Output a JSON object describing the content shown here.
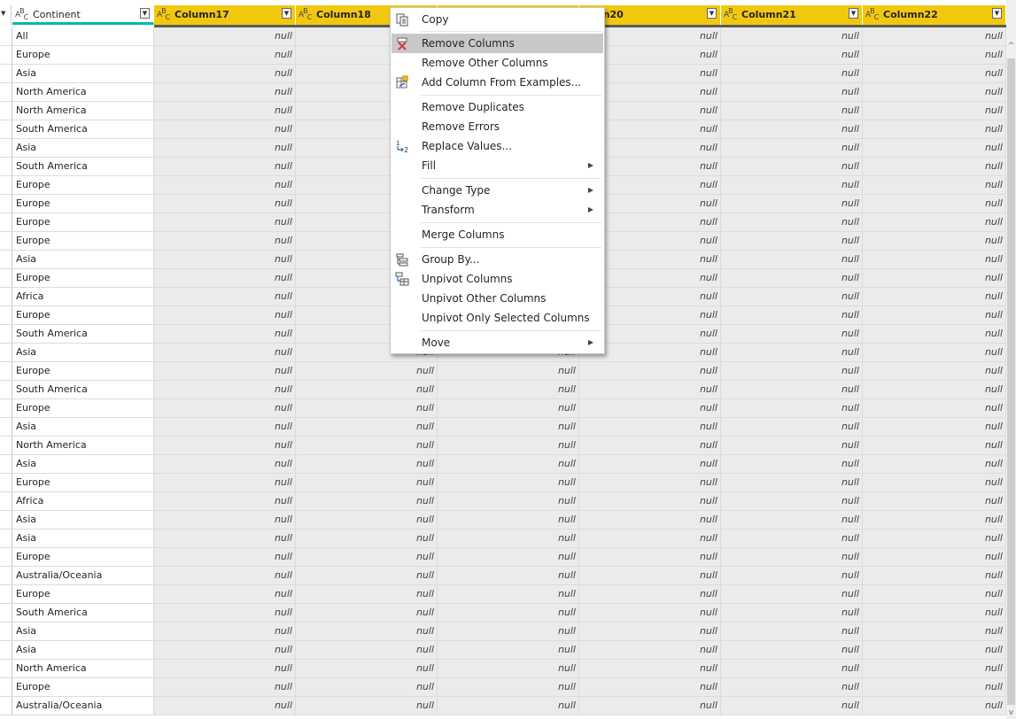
{
  "columns": {
    "continent": "Continent",
    "type_marker": "ABC",
    "c17": "Column17",
    "c18": "Column18",
    "c20": "Column20",
    "c21": "Column21",
    "c22": "Column22"
  },
  "null_text": "null",
  "rows": [
    "All",
    "Europe",
    "Asia",
    "North America",
    "North America",
    "South America",
    "Asia",
    "South America",
    "Europe",
    "Europe",
    "Europe",
    "Europe",
    "Asia",
    "Europe",
    "Africa",
    "Europe",
    "South America",
    "Asia",
    "Europe",
    "South America",
    "Europe",
    "Asia",
    "North America",
    "Asia",
    "Europe",
    "Africa",
    "Asia",
    "Asia",
    "Europe",
    "Australia/Oceania",
    "Europe",
    "South America",
    "Asia",
    "Asia",
    "North America",
    "Europe",
    "Australia/Oceania"
  ],
  "context_menu": {
    "items": [
      {
        "label": "Copy",
        "icon": "copy-icon"
      },
      {
        "label": "Remove Columns",
        "icon": "remove-columns-icon",
        "highlighted": true
      },
      {
        "label": "Remove Other Columns"
      },
      {
        "label": "Add Column From Examples...",
        "icon": "add-column-from-examples-icon"
      },
      {
        "label": "Remove Duplicates"
      },
      {
        "label": "Remove Errors"
      },
      {
        "label": "Replace Values...",
        "icon": "replace-values-icon"
      },
      {
        "label": "Fill",
        "submenu": true
      },
      {
        "label": "Change Type",
        "submenu": true
      },
      {
        "label": "Transform",
        "submenu": true
      },
      {
        "label": "Merge Columns"
      },
      {
        "label": "Group By...",
        "icon": "group-by-icon"
      },
      {
        "label": "Unpivot Columns",
        "icon": "unpivot-columns-icon"
      },
      {
        "label": "Unpivot Other Columns"
      },
      {
        "label": "Unpivot Only Selected Columns"
      },
      {
        "label": "Move",
        "submenu": true
      }
    ]
  },
  "colors": {
    "header": "#f2c80f",
    "highlight": "#c8c8c8",
    "continent_underline": "#01b8aa",
    "null_bg": "#ebebeb"
  }
}
